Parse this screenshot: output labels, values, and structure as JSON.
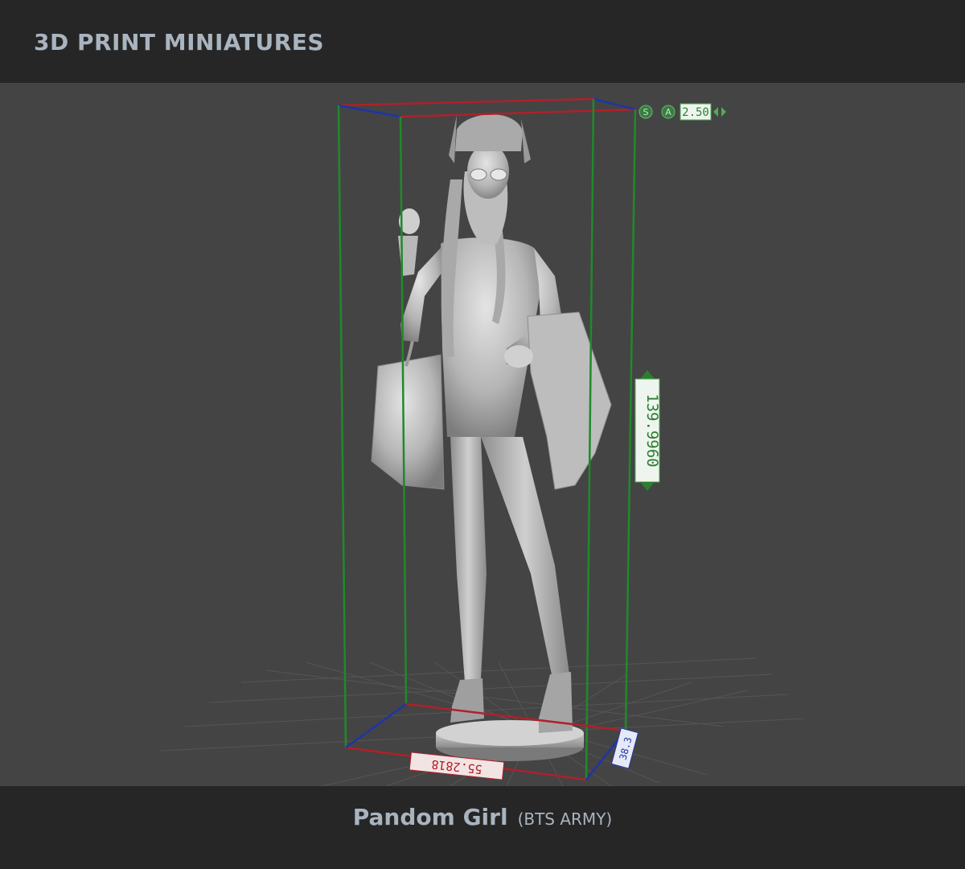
{
  "header": {
    "title": "3D PRINT MINIATURES"
  },
  "viewport": {
    "hud": {
      "s_label": "S",
      "a_label": "A",
      "scale_value": "2.50"
    },
    "dimensions": {
      "height_value": "139.9960",
      "width_value": "55.2818",
      "depth_value": "38.3"
    },
    "colors": {
      "x_axis": "#b0202a",
      "y_axis": "#1f8a2a",
      "z_axis": "#1d35a8",
      "background": "#444444",
      "model": "#b9b9b9"
    }
  },
  "footer": {
    "name": "Pandom Girl",
    "subtitle": "(BTS ARMY)"
  }
}
